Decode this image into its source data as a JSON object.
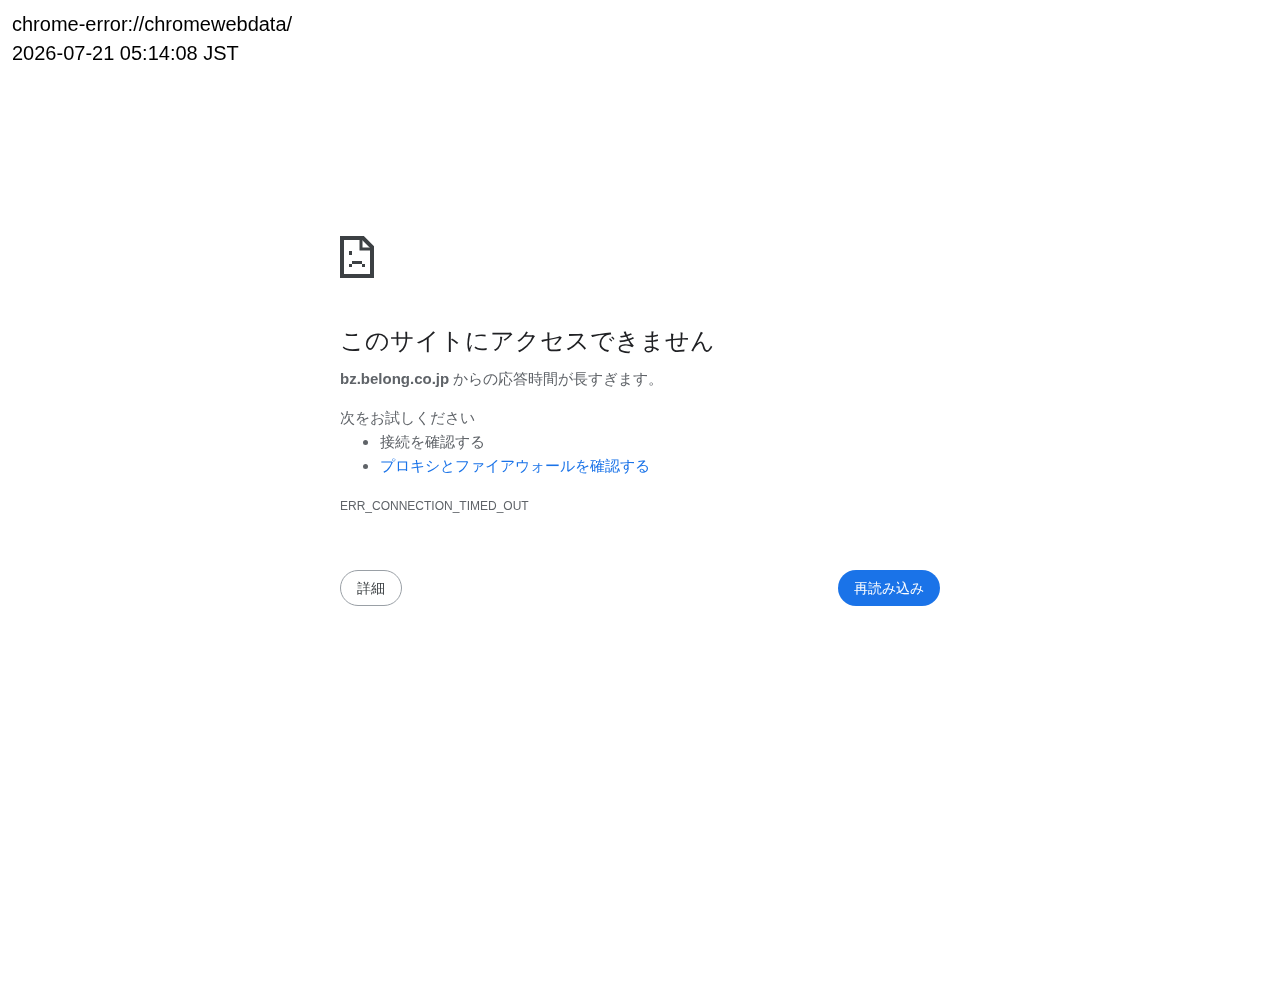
{
  "header": {
    "url": "chrome-error://chromewebdata/",
    "timestamp": "2026-07-21 05:14:08 JST"
  },
  "error": {
    "title": "このサイトにアクセスできません",
    "summary": "**bz.belong.co.jp** からの応答時間が長すぎます。",
    "suggestions": {
      "heading": "次をお試しください",
      "items": [
        {
          "kind": "text",
          "text": "接続を確認する"
        },
        {
          "kind": "link",
          "text": "プロキシとファイアウォールを確認する"
        }
      ]
    },
    "code": "ERR_CONNECTION_TIMED_OUT"
  },
  "buttons": [
    {
      "kind": "secondary",
      "label": "詳細"
    },
    {
      "kind": "primary",
      "label": "再読み込み"
    }
  ]
}
